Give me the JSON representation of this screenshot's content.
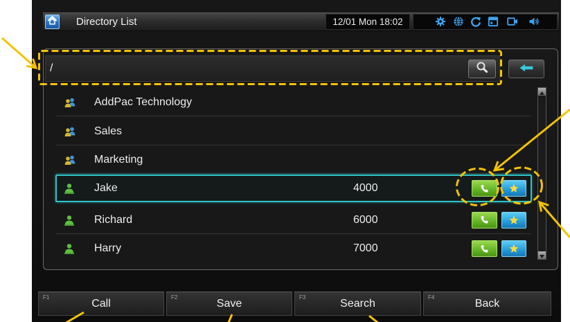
{
  "title_bar": {
    "home_icon": "home-icon",
    "title": "Directory List",
    "datetime": "12/01 Mon 18:02",
    "status_icons": [
      "gear-icon",
      "globe-icon",
      "sync-icon",
      "calendar-icon",
      "video-icon",
      "speaker-icon"
    ]
  },
  "search": {
    "value": "/",
    "search_icon": "search-icon",
    "back_icon": "arrow-left-icon"
  },
  "directory": {
    "rows": [
      {
        "icon": "group-icon",
        "name": "AddPac Technology"
      },
      {
        "icon": "group-icon",
        "name": "Sales"
      },
      {
        "icon": "group-icon",
        "name": "Marketing"
      },
      {
        "icon": "person-icon",
        "name": "Jake",
        "number": "4000",
        "selected": true,
        "call_icon": "phone-icon",
        "favorite_icon": "star-icon"
      },
      {
        "icon": "person-icon",
        "name": "Richard",
        "number": "6000",
        "call_icon": "phone-icon",
        "favorite_icon": "star-icon"
      },
      {
        "icon": "person-icon",
        "name": "Harry",
        "number": "7000",
        "call_icon": "phone-icon",
        "favorite_icon": "star-icon"
      }
    ]
  },
  "function_keys": [
    {
      "key": "F1",
      "label": "Call"
    },
    {
      "key": "F2",
      "label": "Save"
    },
    {
      "key": "F3",
      "label": "Search"
    },
    {
      "key": "F4",
      "label": "Back"
    }
  ],
  "colors": {
    "selection_border": "#2ec4c8",
    "call_button": "#5fb022",
    "favorite_button": "#2196d6",
    "status_icons": "#3ea2f0",
    "annotation": "#f4c300"
  }
}
